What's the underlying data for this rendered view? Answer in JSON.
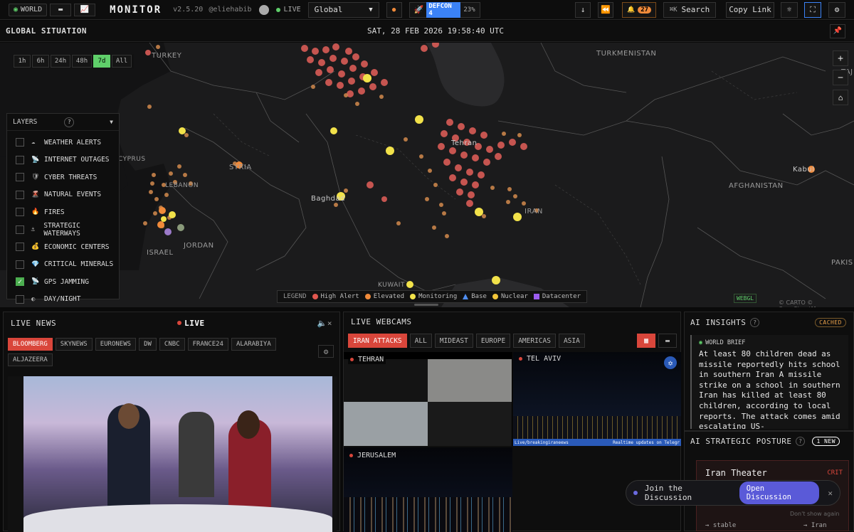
{
  "topbar": {
    "world_label": "WORLD",
    "app_title": "MONITOR",
    "version": "v2.5.20",
    "handle": "@eliehabib",
    "live_label": "LIVE",
    "region_value": "Global",
    "defcon_label": "DEFCON 4",
    "defcon_percent": "23%",
    "alert_count": "27",
    "search_shortcut": "⌘K",
    "search_label": "Search",
    "copy_link_label": "Copy Link"
  },
  "map": {
    "section_title": "GLOBAL SITUATION",
    "datetime": "SAT, 28 FEB 2026 19:58:40 UTC",
    "time_ranges": [
      "1h",
      "6h",
      "24h",
      "48h",
      "7d",
      "All"
    ],
    "active_time_range": "7d",
    "labels": {
      "turkey": "TURKEY",
      "turkmenistan": "TURKMENISTAN",
      "syria": "SYRIA",
      "lebanon": "LEBANON",
      "cyprus": "CYPRUS",
      "israel": "ISRAEL",
      "jordan": "JORDAN",
      "baghdad": "Baghdad",
      "tehran": "Tehran",
      "iran": "IRAN",
      "afghanistan": "AFGHANISTAN",
      "kabul": "Kabul",
      "kuwait": "KUWAIT",
      "pakistan": "PAKIS",
      "tajik": "TAJ"
    },
    "webgl_badge": "WEBGL",
    "attribution": "© CARTO © OpenStreetMap"
  },
  "layers": {
    "title": "LAYERS",
    "help": "?",
    "items": [
      {
        "label": "WEATHER ALERTS",
        "icon": "cloud-icon",
        "checked": false
      },
      {
        "label": "INTERNET OUTAGES",
        "icon": "satellite-icon",
        "checked": false
      },
      {
        "label": "CYBER THREATS",
        "icon": "shield-icon",
        "checked": false
      },
      {
        "label": "NATURAL EVENTS",
        "icon": "volcano-icon",
        "checked": false
      },
      {
        "label": "FIRES",
        "icon": "fire-icon",
        "checked": false
      },
      {
        "label": "STRATEGIC WATERWAYS",
        "icon": "anchor-icon",
        "checked": false
      },
      {
        "label": "ECONOMIC CENTERS",
        "icon": "money-bag-icon",
        "checked": false
      },
      {
        "label": "CRITICAL MINERALS",
        "icon": "gem-icon",
        "checked": false
      },
      {
        "label": "GPS JAMMING",
        "icon": "satellite-icon",
        "checked": true
      },
      {
        "label": "DAY/NIGHT",
        "icon": "moon-icon",
        "checked": false
      }
    ]
  },
  "legend": {
    "title": "LEGEND",
    "items": [
      {
        "label": "High Alert",
        "color": "#e0574f",
        "shape": "dot"
      },
      {
        "label": "Elevated",
        "color": "#f08a3a",
        "shape": "dot"
      },
      {
        "label": "Monitoring",
        "color": "#f2e24a",
        "shape": "dot"
      },
      {
        "label": "Base",
        "color": "#4f8df0",
        "shape": "triangle"
      },
      {
        "label": "Nuclear",
        "color": "#f2c53a",
        "shape": "dot"
      },
      {
        "label": "Datacenter",
        "color": "#9b5cf0",
        "shape": "square"
      }
    ]
  },
  "news": {
    "title": "LIVE NEWS",
    "live_label": "LIVE",
    "channels": [
      "BLOOMBERG",
      "SKYNEWS",
      "EURONEWS",
      "DW",
      "CNBC",
      "FRANCE24",
      "ALARABIYA",
      "ALJAZEERA"
    ],
    "active_channel": "BLOOMBERG"
  },
  "webcams": {
    "title": "LIVE WEBCAMS",
    "tabs": [
      "IRAN ATTACKS",
      "ALL",
      "MIDEAST",
      "EUROPE",
      "AMERICAS",
      "ASIA"
    ],
    "active_tab": "IRAN ATTACKS",
    "cams": [
      {
        "name": "TEHRAN"
      },
      {
        "name": "TEL AVIV"
      },
      {
        "name": "JERUSALEM"
      }
    ],
    "ticker_text": "Live/breakingiraneews",
    "ticker_right": "Realtime updates on Telegr"
  },
  "insights": {
    "title": "AI INSIGHTS",
    "cached_badge": "CACHED",
    "brief_title": "WORLD BRIEF",
    "brief_text": "At least 80 children dead as missile reportedly hits school in southern Iran A missile strike on a school in southern Iran has killed at least 80 children, according to local reports. The attack comes amid escalating US-"
  },
  "posture": {
    "title": "AI STRATEGIC POSTURE",
    "new_badge": "1 NEW",
    "theater_name": "Iran Theater",
    "theater_level": "CRIT",
    "status_left": "→ stable",
    "status_right": "→ Iran"
  },
  "discussion": {
    "label": "Join the Discussion",
    "button": "Open Discussion",
    "dont_show": "Don't show again"
  }
}
